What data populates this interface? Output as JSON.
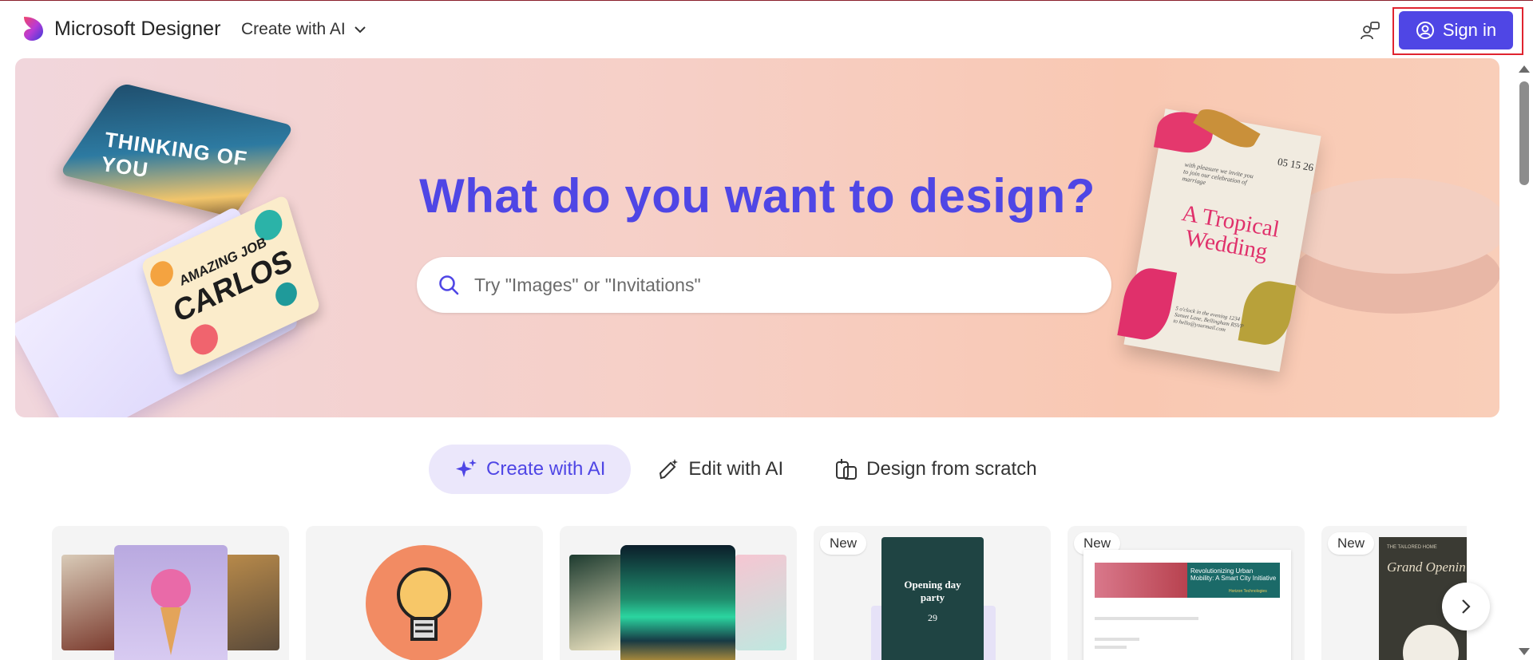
{
  "header": {
    "brand_name": "Microsoft Designer",
    "create_menu_label": "Create with AI",
    "signin_label": "Sign in"
  },
  "hero": {
    "title": "What do you want to design?",
    "search_placeholder": "Try \"Images\" or \"Invitations\""
  },
  "decor": {
    "card_thinking_text": "THINKING OF YOU",
    "card_carlos_top": "AMAZING JOB",
    "card_carlos_main": "CARLOS",
    "wedding_title": "A Tropical Wedding",
    "wedding_date": "05 15 26",
    "wedding_invite": "with pleasure we invite you to join our celebration of marriage",
    "wedding_details": "5 o'clock in the evening 1234 Sunset Lane, Bellingham RSVP to hello@yourmail.com"
  },
  "tabs": [
    {
      "label": "Create with AI",
      "active": true
    },
    {
      "label": "Edit with AI",
      "active": false
    },
    {
      "label": "Design from scratch",
      "active": false
    }
  ],
  "templates": {
    "badge": "New",
    "invite_title": "Opening day party",
    "invite_day": "29",
    "banner_title": "Revolutionizing Urban Mobility: A Smart City Initiative",
    "banner_sub": "Horizon Technologies",
    "grand_title": "Grand Openin",
    "grand_small": "THE TAILORED HOME"
  },
  "colors": {
    "accent": "#4f46e5",
    "highlight_frame": "#e0242f"
  }
}
